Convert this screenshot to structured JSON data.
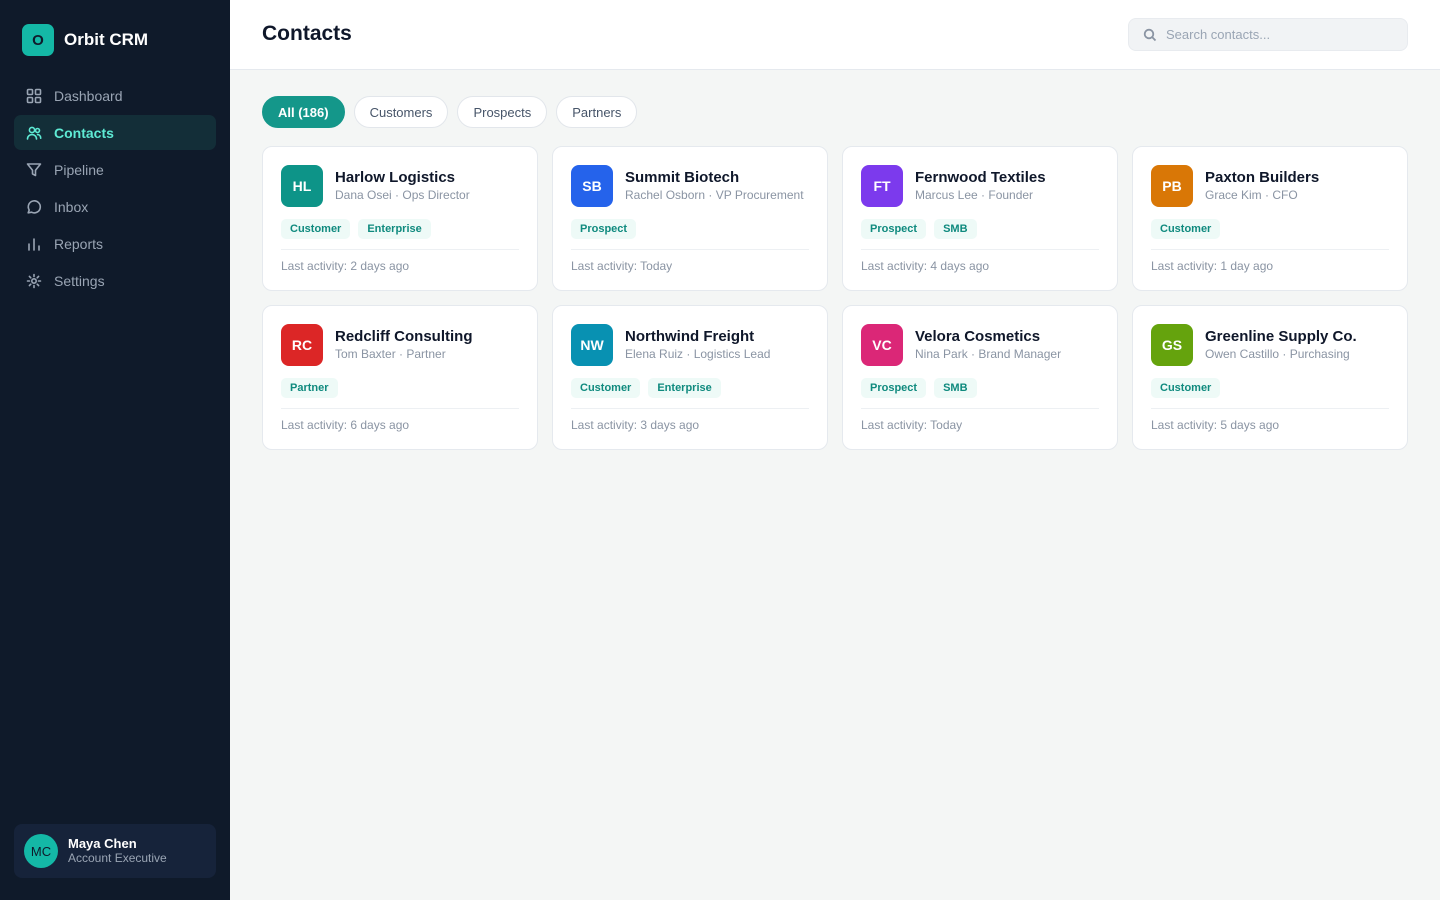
{
  "app": {
    "name": "Orbit CRM",
    "logo_letter": "O"
  },
  "sidebar": {
    "items": [
      {
        "label": "Dashboard",
        "icon": "grid-icon",
        "active": false
      },
      {
        "label": "Contacts",
        "icon": "users-icon",
        "active": true
      },
      {
        "label": "Pipeline",
        "icon": "filter-icon",
        "active": false
      },
      {
        "label": "Inbox",
        "icon": "chat-icon",
        "active": false
      },
      {
        "label": "Reports",
        "icon": "bar-chart-icon",
        "active": false
      },
      {
        "label": "Settings",
        "icon": "gear-icon",
        "active": false
      }
    ]
  },
  "user": {
    "initials": "MC",
    "name": "Maya Chen",
    "role": "Account Executive"
  },
  "header": {
    "title": "Contacts",
    "search_placeholder": "Search contacts..."
  },
  "filters": [
    {
      "label": "All (186)",
      "active": true
    },
    {
      "label": "Customers",
      "active": false
    },
    {
      "label": "Prospects",
      "active": false
    },
    {
      "label": "Partners",
      "active": false
    }
  ],
  "contacts": [
    {
      "initials": "HL",
      "color": "#0d9488",
      "company": "Harlow Logistics",
      "person": "Dana Osei · Ops Director",
      "tags": [
        "Customer",
        "Enterprise"
      ],
      "activity": "Last activity: 2 days ago"
    },
    {
      "initials": "SB",
      "color": "#2563eb",
      "company": "Summit Biotech",
      "person": "Rachel Osborn · VP Procurement",
      "tags": [
        "Prospect"
      ],
      "activity": "Last activity: Today"
    },
    {
      "initials": "FT",
      "color": "#7c3aed",
      "company": "Fernwood Textiles",
      "person": "Marcus Lee · Founder",
      "tags": [
        "Prospect",
        "SMB"
      ],
      "activity": "Last activity: 4 days ago"
    },
    {
      "initials": "PB",
      "color": "#d97706",
      "company": "Paxton Builders",
      "person": "Grace Kim · CFO",
      "tags": [
        "Customer"
      ],
      "activity": "Last activity: 1 day ago"
    },
    {
      "initials": "RC",
      "color": "#dc2626",
      "company": "Redcliff Consulting",
      "person": "Tom Baxter · Partner",
      "tags": [
        "Partner"
      ],
      "activity": "Last activity: 6 days ago"
    },
    {
      "initials": "NW",
      "color": "#0891b2",
      "company": "Northwind Freight",
      "person": "Elena Ruiz · Logistics Lead",
      "tags": [
        "Customer",
        "Enterprise"
      ],
      "activity": "Last activity: 3 days ago"
    },
    {
      "initials": "VC",
      "color": "#db2777",
      "company": "Velora Cosmetics",
      "person": "Nina Park · Brand Manager",
      "tags": [
        "Prospect",
        "SMB"
      ],
      "activity": "Last activity: Today"
    },
    {
      "initials": "GS",
      "color": "#65a30d",
      "company": "Greenline Supply Co.",
      "person": "Owen Castillo · Purchasing",
      "tags": [
        "Customer"
      ],
      "activity": "Last activity: 5 days ago"
    }
  ]
}
